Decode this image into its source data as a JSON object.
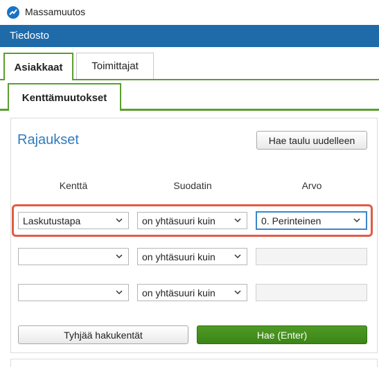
{
  "window": {
    "title": "Massamuutos",
    "icon": "app-logo-icon"
  },
  "menubar": {
    "items": [
      "Tiedosto"
    ],
    "color": "#1f6aa8"
  },
  "tabs": [
    {
      "label": "Asiakkaat",
      "active": true
    },
    {
      "label": "Toimittajat",
      "active": false
    }
  ],
  "subtabs": [
    {
      "label": "Kenttämuutokset",
      "active": true
    }
  ],
  "accent_color": "#5a9e2f",
  "filters": {
    "title": "Rajaukset",
    "refresh_label": "Hae taulu uudelleen",
    "columns": {
      "field": "Kenttä",
      "filter": "Suodatin",
      "value": "Arvo"
    },
    "rows": [
      {
        "field": "Laskutustapa",
        "filter": "on yhtäsuuri kuin",
        "value": "0. Perinteinen",
        "value_type": "dropdown",
        "highlighted": true
      },
      {
        "field": "",
        "filter": "on yhtäsuuri kuin",
        "value": "",
        "value_type": "text",
        "highlighted": false
      },
      {
        "field": "",
        "filter": "on yhtäsuuri kuin",
        "value": "",
        "value_type": "text",
        "highlighted": false
      }
    ],
    "clear_label": "Tyhjää hakukentät",
    "search_label": "Hae (Enter)"
  },
  "highlight_color": "#e25a44"
}
